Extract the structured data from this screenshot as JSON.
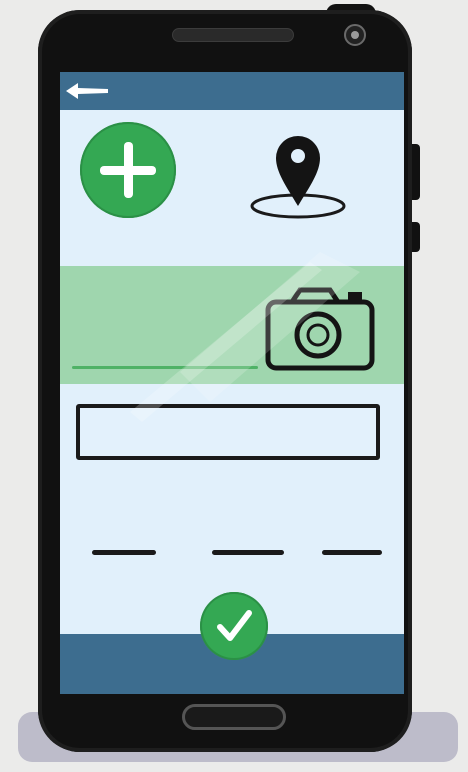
{
  "screen": {
    "app_bar": {
      "back_icon": "arrow-left-icon"
    },
    "actions": {
      "add_icon": "plus-icon",
      "location_icon": "map-pin-icon",
      "camera_icon": "camera-icon",
      "confirm_icon": "checkmark-icon"
    },
    "input": {
      "value": "",
      "placeholder": ""
    },
    "dashes_count": 3
  },
  "colors": {
    "app_bar": "#3d6d8f",
    "screen_bg": "#e1f0fb",
    "accent_green": "#34a853",
    "band_green": "#9fd6ae",
    "phone_body": "#111111"
  }
}
